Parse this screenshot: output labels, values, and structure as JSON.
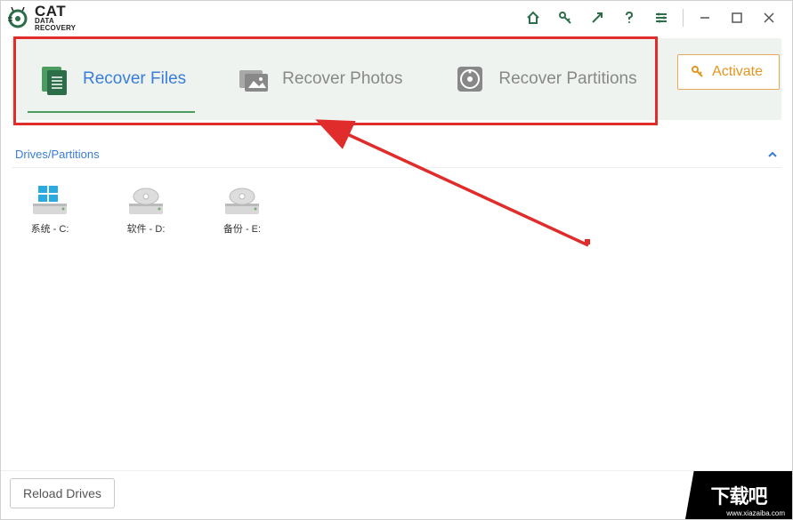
{
  "app": {
    "logo_main": "CAT",
    "logo_sub1": "DATA",
    "logo_sub2": "RECOVERY"
  },
  "tabs": {
    "files": "Recover Files",
    "photos": "Recover Photos",
    "partitions": "Recover Partitions"
  },
  "activate": {
    "label": "Activate"
  },
  "section": {
    "title": "Drives/Partitions"
  },
  "drives": [
    {
      "label": "系统 - C:",
      "type": "windows"
    },
    {
      "label": "软件 - D:",
      "type": "disk"
    },
    {
      "label": "备份 - E:",
      "type": "disk"
    }
  ],
  "footer": {
    "reload": "Reload Drives"
  },
  "watermark": {
    "text": "下载吧",
    "url": "www.xiazaiba.com"
  },
  "colors": {
    "accent_green": "#2c6e49",
    "accent_blue": "#3a7dd8",
    "accent_orange": "#e6951f",
    "highlight_red": "#e12c2c"
  }
}
